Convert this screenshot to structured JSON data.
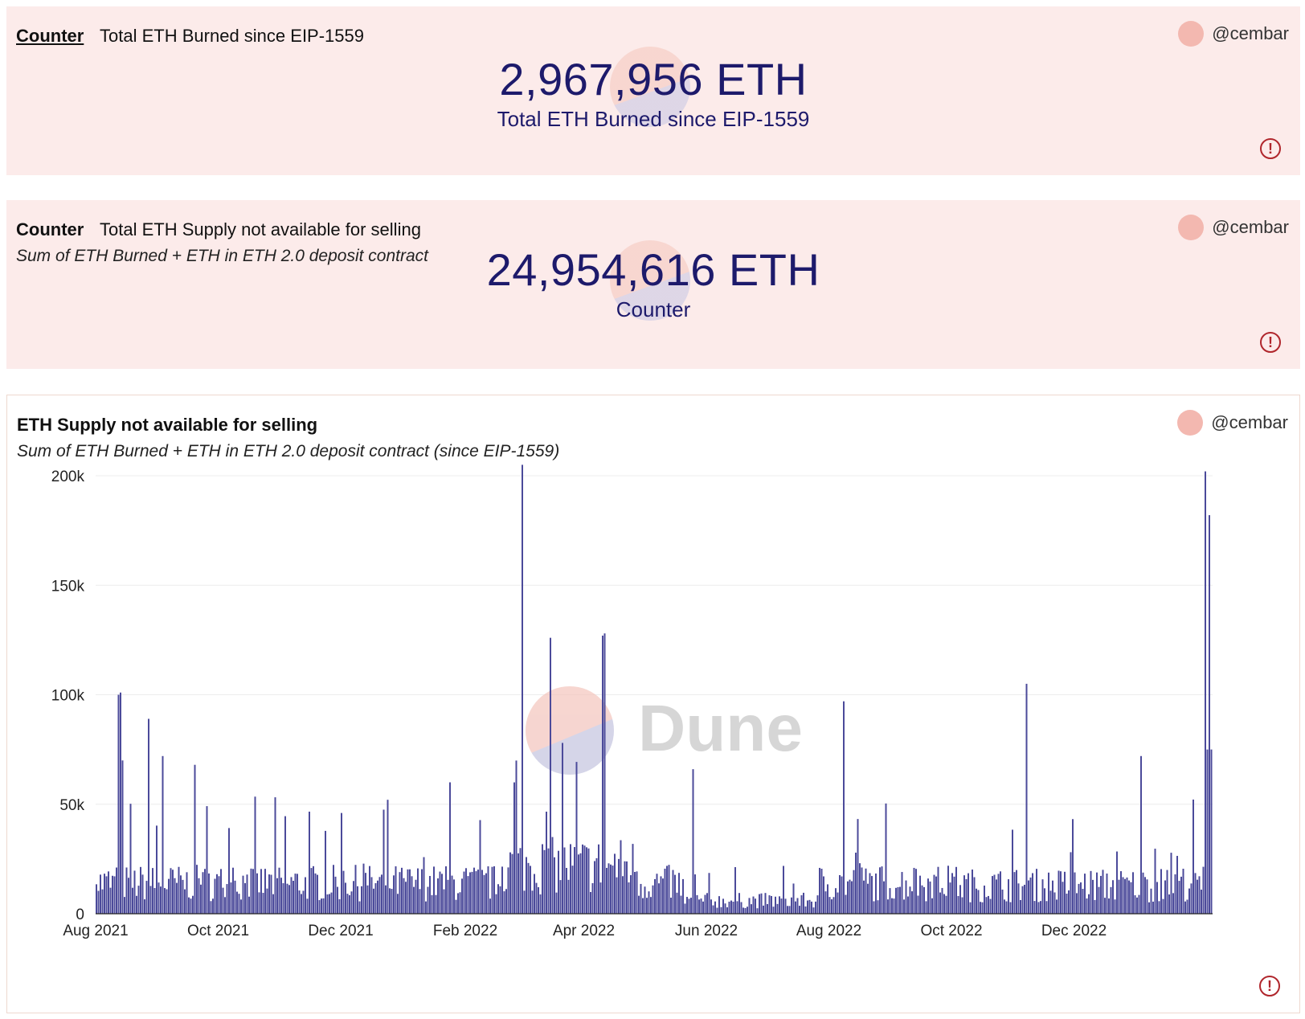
{
  "card1": {
    "kind": "Counter",
    "title": "Total ETH Burned since EIP-1559",
    "author": "@cembar",
    "value": "2,967,956 ETH",
    "label": "Total ETH Burned since EIP-1559"
  },
  "card2": {
    "kind": "Counter",
    "title": "Total ETH Supply not available for selling",
    "subtitle": "Sum of ETH Burned + ETH in ETH 2.0 deposit contract",
    "author": "@cembar",
    "value": "24,954,616 ETH",
    "label": "Counter"
  },
  "card3": {
    "title": "ETH Supply not available for selling",
    "subtitle": "Sum of ETH Burned + ETH in ETH 2.0 deposit contract (since EIP-1559)",
    "author": "@cembar",
    "watermark": "Dune"
  },
  "colors": {
    "bar": "#4b4a9a",
    "counter_text": "#1d1a6b",
    "card_pink": "#fcebea",
    "alert": "#b0262c"
  },
  "chart_data": {
    "type": "bar",
    "title": "ETH Supply not available for selling",
    "xlabel": "",
    "ylabel": "",
    "ylim": [
      0,
      200000
    ],
    "y_ticks": [
      "0",
      "50k",
      "100k",
      "150k",
      "200k"
    ],
    "y_tick_values": [
      0,
      50000,
      100000,
      150000,
      200000
    ],
    "x_ticks": [
      "Aug 2021",
      "Oct 2021",
      "Dec 2021",
      "Feb 2022",
      "Apr 2022",
      "Jun 2022",
      "Aug 2022",
      "Oct 2022",
      "Dec 2022"
    ],
    "x_tick_dates": [
      "2021-08-01",
      "2021-10-01",
      "2021-12-01",
      "2022-02-01",
      "2022-04-01",
      "2022-06-01",
      "2022-08-01",
      "2022-10-01",
      "2022-12-01"
    ],
    "grid": true,
    "legend": "none",
    "series": [
      {
        "start": "2021-08-01",
        "interval": "day",
        "peaks": [
          {
            "date": "2021-08-12",
            "value": 100000
          },
          {
            "date": "2021-08-13",
            "value": 101000
          },
          {
            "date": "2021-08-14",
            "value": 70000
          },
          {
            "date": "2021-08-27",
            "value": 89000
          },
          {
            "date": "2021-09-03",
            "value": 72000
          },
          {
            "date": "2021-09-19",
            "value": 68000
          },
          {
            "date": "2022-01-24",
            "value": 60000
          },
          {
            "date": "2022-03-01",
            "value": 205000
          },
          {
            "date": "2022-03-15",
            "value": 126000
          },
          {
            "date": "2022-03-21",
            "value": 78000
          },
          {
            "date": "2022-04-10",
            "value": 127000
          },
          {
            "date": "2022-04-11",
            "value": 128000
          },
          {
            "date": "2022-05-25",
            "value": 66000
          },
          {
            "date": "2022-08-08",
            "value": 97000
          },
          {
            "date": "2022-11-07",
            "value": 105000
          },
          {
            "date": "2023-01-03",
            "value": 72000
          },
          {
            "date": "2023-02-04",
            "value": 202000
          },
          {
            "date": "2023-02-05",
            "value": 75000
          },
          {
            "date": "2023-02-06",
            "value": 182000
          },
          {
            "date": "2023-02-07",
            "value": 75000
          }
        ],
        "note_values": "Remaining daily values are mostly between 5k and 50k ETH."
      }
    ]
  }
}
